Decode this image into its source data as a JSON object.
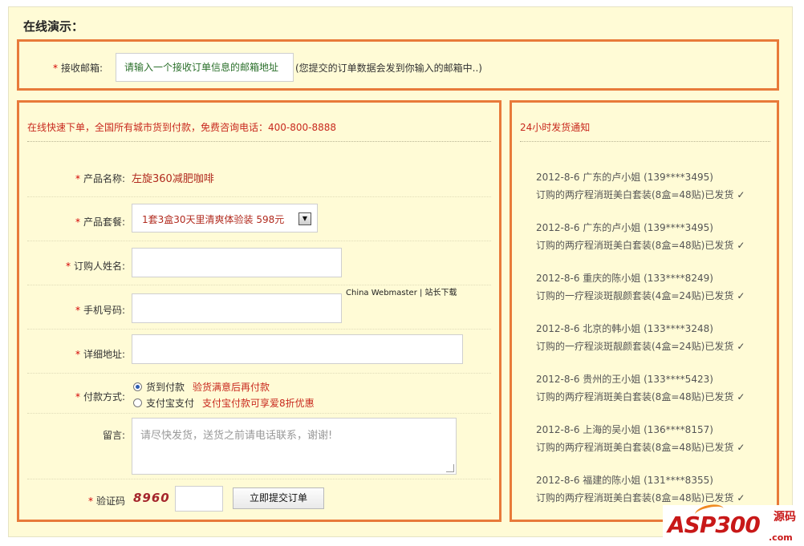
{
  "page_title": "在线演示：",
  "email_section": {
    "required_mark": "*",
    "label": "接收邮箱:",
    "input_value": "请输入一个接收订单信息的邮箱地址",
    "hint": "(您提交的订单数据会发到你输入的邮箱中..)"
  },
  "order_form": {
    "header": "在线快速下单，全国所有城市货到付款，免费咨询电话：400-800-8888",
    "product_name": {
      "label": "产品名称:",
      "value": "左旋360减肥咖啡"
    },
    "product_package": {
      "label": "产品套餐:",
      "selected": "1套3盒30天里清爽体验装 598元"
    },
    "buyer_name": {
      "label": "订购人姓名:",
      "value": ""
    },
    "phone": {
      "label": "手机号码:",
      "value": ""
    },
    "address": {
      "label": "详细地址:",
      "value": ""
    },
    "payment": {
      "label": "付款方式:",
      "options": [
        {
          "label": "货到付款",
          "note": "验货满意后再付款",
          "checked": true
        },
        {
          "label": "支付宝支付",
          "note": "支付宝付款可享爱8折优惠",
          "checked": false
        }
      ]
    },
    "message": {
      "label": "留言:",
      "placeholder": "请尽快发货，送货之前请电话联系，谢谢!"
    },
    "captcha": {
      "label": "验证码",
      "code": "8960",
      "value": ""
    },
    "submit_label": "立即提交订单"
  },
  "watermark_text": "China Webmaster | 站长下载",
  "notice": {
    "header": "24小时发货通知",
    "check_mark": "✓",
    "items": [
      {
        "line1": "2012-8-6  广东的卢小姐 (139****3495)",
        "line2": "订购的两疗程消斑美白套装(8盒=48贴)已发货"
      },
      {
        "line1": "2012-8-6  广东的卢小姐 (139****3495)",
        "line2": "订购的两疗程消斑美白套装(8盒=48贴)已发货"
      },
      {
        "line1": "2012-8-6  重庆的陈小姐 (133****8249)",
        "line2": "订购的一疗程淡斑靓颜套装(4盒=24贴)已发货"
      },
      {
        "line1": "2012-8-6  北京的韩小姐 (133****3248)",
        "line2": "订购的一疗程淡斑靓颜套装(4盒=24贴)已发货"
      },
      {
        "line1": "2012-8-6  贵州的王小姐 (133****5423)",
        "line2": "订购的两疗程消斑美白套装(8盒=48贴)已发货"
      },
      {
        "line1": "2012-8-6  上海的吴小姐 (136****8157)",
        "line2": "订购的两疗程消斑美白套装(8盒=48贴)已发货"
      },
      {
        "line1": "2012-8-6  福建的陈小姐 (131****8355)",
        "line2": "订购的两疗程消斑美白套装(8盒=48贴)已发货"
      }
    ]
  },
  "logo": {
    "main": "ASP300",
    "sub": "源码",
    "url": ".com"
  },
  "colors": {
    "accent_border": "#e87a3a",
    "background": "#fffbd6",
    "header_red": "#c8291e"
  }
}
